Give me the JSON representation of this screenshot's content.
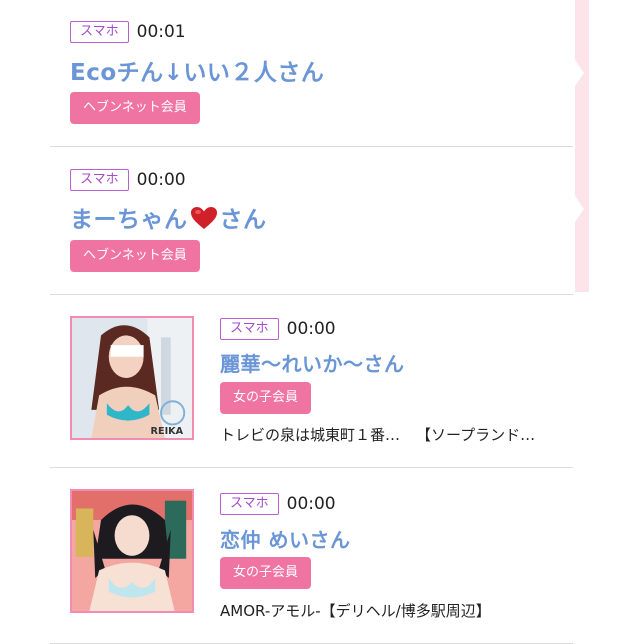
{
  "entries": [
    {
      "device": "スマホ",
      "time": "00:01",
      "name": "Ecoチん↓いい２人さん",
      "member_type": "ヘブンネット会員"
    },
    {
      "device": "スマホ",
      "time": "00:00",
      "name_before": "まーちゃん",
      "name_after": "さん",
      "member_type": "ヘブンネット会員"
    },
    {
      "device": "スマホ",
      "time": "00:00",
      "name": "麗華〜れいか〜さん",
      "member_type": "女の子会員",
      "shop": "トレビの泉は城東町１番…",
      "shop2": "【ソープランド…",
      "photo_label": "REIKA"
    },
    {
      "device": "スマホ",
      "time": "00:00",
      "name": "恋仲 めいさん",
      "member_type": "女の子会員",
      "shop": "AMOR-アモル-【デリヘル/博多駅周辺】"
    }
  ],
  "colors": {
    "accent_pink": "#f074a1",
    "name_blue": "#6a95d6",
    "badge_purple": "#a64bd0",
    "heart": "#d0202a"
  }
}
